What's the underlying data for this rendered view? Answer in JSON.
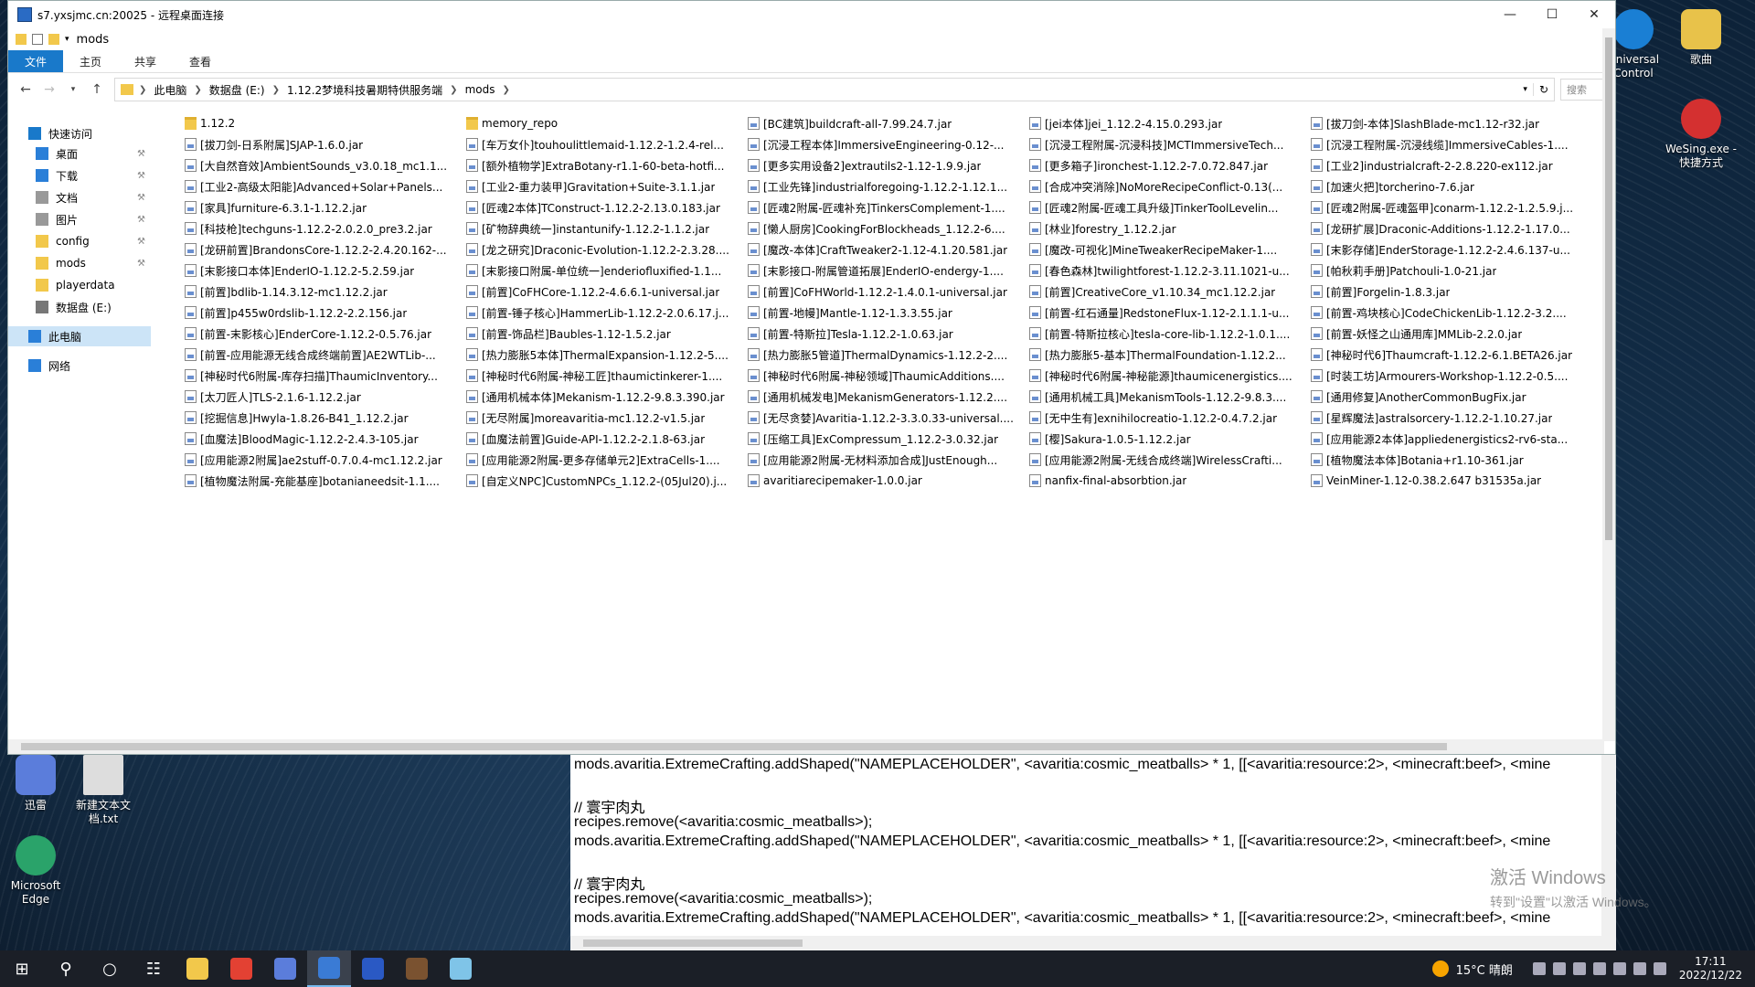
{
  "window": {
    "title": "s7.yxsjmc.cn:20025 - 远程桌面连接",
    "path_label": "mods"
  },
  "ribbon": {
    "tabs": [
      "文件",
      "主页",
      "共享",
      "查看"
    ]
  },
  "address": {
    "crumbs": [
      "此电脑",
      "数据盘 (E:)",
      "1.12.2梦境科技暑期特供服务端",
      "mods"
    ],
    "search_placeholder": "搜索"
  },
  "nav": {
    "items": [
      {
        "label": "快速访问",
        "icon": "star-icon",
        "pinned": false
      },
      {
        "label": "桌面",
        "icon": "desktop-icon",
        "pinned": true
      },
      {
        "label": "下载",
        "icon": "download-icon",
        "pinned": true
      },
      {
        "label": "文档",
        "icon": "document-icon",
        "pinned": true
      },
      {
        "label": "图片",
        "icon": "picture-icon",
        "pinned": true
      },
      {
        "label": "config",
        "icon": "folder-icon",
        "pinned": true
      },
      {
        "label": "mods",
        "icon": "folder-icon",
        "pinned": true
      },
      {
        "label": "playerdata",
        "icon": "folder-icon",
        "pinned": false
      },
      {
        "label": "数据盘 (E:)",
        "icon": "drive-icon",
        "pinned": false
      },
      {
        "label": "此电脑",
        "icon": "computer-icon",
        "pinned": false,
        "selected": true
      },
      {
        "label": "网络",
        "icon": "network-icon",
        "pinned": false
      }
    ]
  },
  "files": [
    [
      "1.12.2",
      "memory_repo",
      "[BC建筑]buildcraft-all-7.99.24.7.jar",
      "[jei本体]jei_1.12.2-4.15.0.293.jar",
      "[拔刀剑-本体]SlashBlade-mc1.12-r32.jar"
    ],
    [
      "[拔刀剑-日系附属]SJAP-1.6.0.jar",
      "[车万女仆]touhoulittlemaid-1.12.2-1.2.4-rel...",
      "[沉浸工程本体]ImmersiveEngineering-0.12-...",
      "[沉浸工程附属-沉浸科技]MCTImmersiveTech...",
      "[沉浸工程附属-沉浸线缆]ImmersiveCables-1...."
    ],
    [
      "[大自然音效]AmbientSounds_v3.0.18_mc1.1...",
      "[额外植物学]ExtraBotany-r1.1-60-beta-hotfi...",
      "[更多实用设备2]extrautils2-1.12-1.9.9.jar",
      "[更多箱子]ironchest-1.12.2-7.0.72.847.jar",
      "[工业2]industrialcraft-2-2.8.220-ex112.jar"
    ],
    [
      "[工业2-高级太阳能]Advanced+Solar+Panels...",
      "[工业2-重力装甲]Gravitation+Suite-3.1.1.jar",
      "[工业先锋]industrialforegoing-1.12.2-1.12.1...",
      "[合成冲突消除]NoMoreRecipeConflict-0.13(...",
      "[加速火把]torcherino-7.6.jar"
    ],
    [
      "[家具]furniture-6.3.1-1.12.2.jar",
      "[匠魂2本体]TConstruct-1.12.2-2.13.0.183.jar",
      "[匠魂2附属-匠魂补充]TinkersComplement-1....",
      "[匠魂2附属-匠魂工具升级]TinkerToolLevelin...",
      "[匠魂2附属-匠魂盔甲]conarm-1.12.2-1.2.5.9.j..."
    ],
    [
      "[科技枪]techguns-1.12.2-2.0.2.0_pre3.2.jar",
      "[矿物辞典统一]instantunify-1.12.2-1.1.2.jar",
      "[懒人厨房]CookingForBlockheads_1.12.2-6....",
      "[林业]forestry_1.12.2.jar",
      "[龙研扩展]Draconic-Additions-1.12.2-1.17.0..."
    ],
    [
      "[龙研前置]BrandonsCore-1.12.2-2.4.20.162-...",
      "[龙之研究]Draconic-Evolution-1.12.2-2.3.28....",
      "[魔改-本体]CraftTweaker2-1.12-4.1.20.581.jar",
      "[魔改-可视化]MineTweakerRecipeMaker-1....",
      "[末影存储]EnderStorage-1.12.2-2.4.6.137-u..."
    ],
    [
      "[末影接口本体]EnderIO-1.12.2-5.2.59.jar",
      "[末影接口附属-单位统一]enderiofluxified-1.1...",
      "[末影接口-附属管道拓展]EnderIO-endergy-1....",
      "[春色森林]twilightforest-1.12.2-3.11.1021-u...",
      "[帕秋莉手册]Patchouli-1.0-21.jar"
    ],
    [
      "[前置]bdlib-1.14.3.12-mc1.12.2.jar",
      "[前置]CoFHCore-1.12.2-4.6.6.1-universal.jar",
      "[前置]CoFHWorld-1.12.2-1.4.0.1-universal.jar",
      "[前置]CreativeCore_v1.10.34_mc1.12.2.jar",
      "[前置]Forgelin-1.8.3.jar"
    ],
    [
      "[前置]p455w0rdslib-1.12.2-2.2.156.jar",
      "[前置-锤子核心]HammerLib-1.12.2-2.0.6.17.j...",
      "[前置-地幔]Mantle-1.12-1.3.3.55.jar",
      "[前置-红石通量]RedstoneFlux-1.12-2.1.1.1-u...",
      "[前置-鸡块核心]CodeChickenLib-1.12.2-3.2...."
    ],
    [
      "[前置-末影核心]EnderCore-1.12.2-0.5.76.jar",
      "[前置-饰品栏]Baubles-1.12-1.5.2.jar",
      "[前置-特斯拉]Tesla-1.12.2-1.0.63.jar",
      "[前置-特斯拉核心]tesla-core-lib-1.12.2-1.0.1....",
      "[前置-妖怪之山通用库]MMLib-2.2.0.jar"
    ],
    [
      "[前置-应用能源无线合成终端前置]AE2WTLib-...",
      "[热力膨胀5本体]ThermalExpansion-1.12.2-5....",
      "[热力膨胀5管道]ThermalDynamics-1.12.2-2....",
      "[热力膨胀5-基本]ThermalFoundation-1.12.2...",
      "[神秘时代6]Thaumcraft-1.12.2-6.1.BETA26.jar"
    ],
    [
      "[神秘时代6附属-库存扫描]ThaumicInventory...",
      "[神秘时代6附属-神秘工匠]thaumictinkerer-1....",
      "[神秘时代6附属-神秘领域]ThaumicAdditions....",
      "[神秘时代6附属-神秘能源]thaumicenergistics....",
      "[时装工坊]Armourers-Workshop-1.12.2-0.5...."
    ],
    [
      "[太刀匠人]TLS-2.1.6-1.12.2.jar",
      "[通用机械本体]Mekanism-1.12.2-9.8.3.390.jar",
      "[通用机械发电]MekanismGenerators-1.12.2....",
      "[通用机械工具]MekanismTools-1.12.2-9.8.3....",
      "[通用修复]AnotherCommonBugFix.jar"
    ],
    [
      "[挖掘信息]Hwyla-1.8.26-B41_1.12.2.jar",
      "[无尽附属]moreavaritia-mc1.12.2-v1.5.jar",
      "[无尽贪婪]Avaritia-1.12.2-3.3.0.33-universal....",
      "[无中生有]exnihilocreatio-1.12.2-0.4.7.2.jar",
      "[星辉魔法]astralsorcery-1.12.2-1.10.27.jar"
    ],
    [
      "[血魔法]BloodMagic-1.12.2-2.4.3-105.jar",
      "[血魔法前置]Guide-API-1.12.2-2.1.8-63.jar",
      "[压缩工具]ExCompressum_1.12.2-3.0.32.jar",
      "[樱]Sakura-1.0.5-1.12.2.jar",
      "[应用能源2本体]appliedenergistics2-rv6-sta..."
    ],
    [
      "[应用能源2附属]ae2stuff-0.7.0.4-mc1.12.2.jar",
      "[应用能源2附属-更多存储单元2]ExtraCells-1....",
      "[应用能源2附属-无材料添加合成]JustEnough...",
      "[应用能源2附属-无线合成终端]WirelessCrafti...",
      "[植物魔法本体]Botania+r1.10-361.jar"
    ],
    [
      "[植物魔法附属-充能基座]botanianeedsit-1.1....",
      "[自定义NPC]CustomNPCs_1.12.2-(05Jul20).j...",
      "avaritiarecipemaker-1.0.0.jar",
      "nanfix-final-absorbtion.jar",
      "VeinMiner-1.12-0.38.2.647 b31535a.jar"
    ]
  ],
  "editor": {
    "lines": [
      "mods.avaritia.ExtremeCrafting.addShaped(\"NAMEPLACEHOLDER\", <avaritia:cosmic_meatballs> * 1, [[<avaritia:resource:2>, <minecraft:beef>, <mine",
      "",
      "// 寰宇肉丸",
      "recipes.remove(<avaritia:cosmic_meatballs>);",
      "mods.avaritia.ExtremeCrafting.addShaped(\"NAMEPLACEHOLDER\", <avaritia:cosmic_meatballs> * 1, [[<avaritia:resource:2>, <minecraft:beef>, <mine",
      "",
      "// 寰宇肉丸",
      "recipes.remove(<avaritia:cosmic_meatballs>);",
      "mods.avaritia.ExtremeCrafting.addShaped(\"NAMEPLACEHOLDER\", <avaritia:cosmic_meatballs> * 1, [[<avaritia:resource:2>, <minecraft:beef>, <mine"
    ]
  },
  "watermark": {
    "line1": "激活 Windows",
    "line2": "转到\"设置\"以激活 Windows。"
  },
  "desktop": {
    "icons": [
      {
        "label": "Universal Control",
        "color": "#1a7fd4"
      },
      {
        "label": "歌曲",
        "color": "#e8c24a"
      },
      {
        "label": "WeSing.exe - 快捷方式",
        "color": "#d43030"
      },
      {
        "label": "迅雷",
        "color": "#5b7ddb"
      },
      {
        "label": "新建文本文档.txt",
        "color": "#dddddd"
      },
      {
        "label": "Microsoft Edge",
        "color": "#2aa36a"
      }
    ]
  },
  "taskbar": {
    "apps": [
      {
        "name": "file-explorer-app",
        "color": "#f2c84b"
      },
      {
        "name": "chrome-app",
        "color": "#e34133"
      },
      {
        "name": "xunlei-app",
        "color": "#5b7ddb"
      },
      {
        "name": "remote-desktop-app",
        "color": "#3a7bd5"
      },
      {
        "name": "powershell-app",
        "color": "#2a59c4"
      },
      {
        "name": "minecraft-app",
        "color": "#7a5230"
      },
      {
        "name": "notepad-app",
        "color": "#7fc4e8"
      }
    ],
    "weather": "15°C 晴朗",
    "time": "17:11",
    "date": "2022/12/22"
  }
}
